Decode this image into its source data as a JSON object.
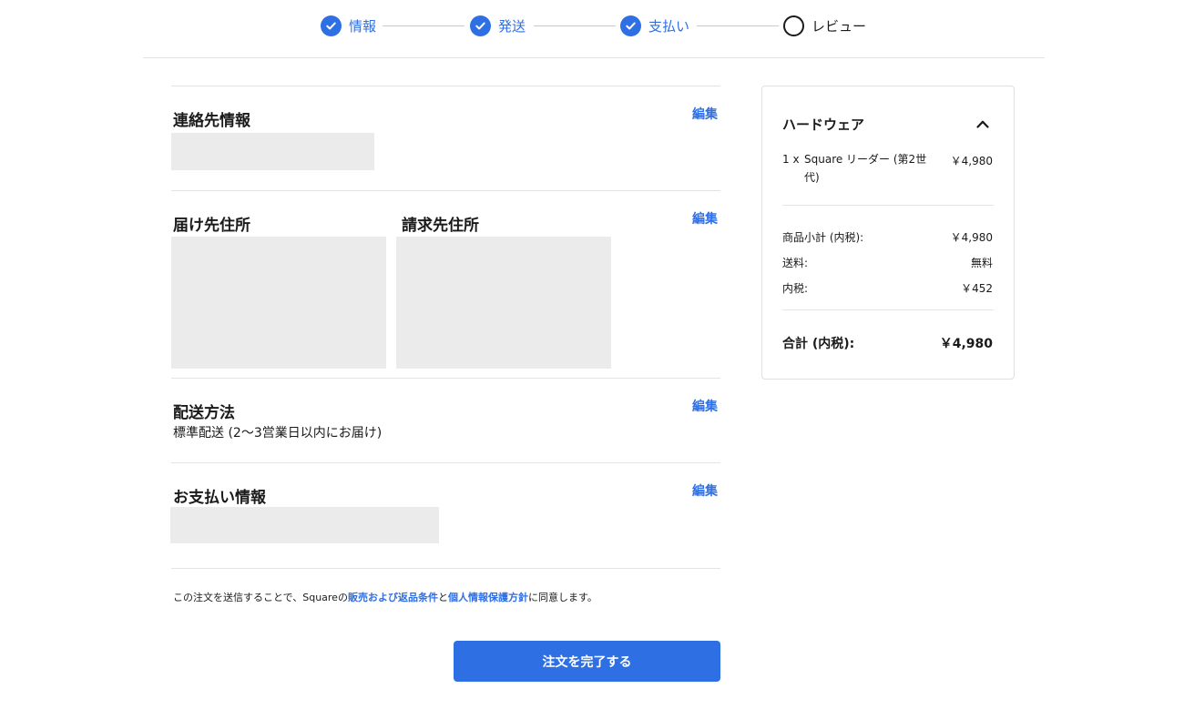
{
  "stepper": {
    "steps": [
      {
        "label": "情報",
        "state": "complete"
      },
      {
        "label": "発送",
        "state": "complete"
      },
      {
        "label": "支払い",
        "state": "complete"
      },
      {
        "label": "レビュー",
        "state": "pending"
      }
    ]
  },
  "sections": {
    "contact": {
      "title": "連絡先情報",
      "edit_label": "編集"
    },
    "addresses": {
      "shipping_title": "届け先住所",
      "billing_title": "請求先住所",
      "edit_label": "編集"
    },
    "shipping_method": {
      "title": "配送方法",
      "value": "標準配送 (2〜3営業日以内にお届け)",
      "edit_label": "編集"
    },
    "payment": {
      "title": "お支払い情報",
      "edit_label": "編集"
    }
  },
  "terms": {
    "prefix": "この注文を送信することで、Square",
    "no": "の",
    "link_sales": "販売および返品条件",
    "and": "と",
    "link_privacy": "個人情報保護方針",
    "suffix": "に同意します。"
  },
  "submit": {
    "label": "注文を完了する"
  },
  "summary": {
    "title": "ハードウェア",
    "item": {
      "qty": "1 x",
      "name": "Square リーダー (第2世代)",
      "price": "￥4,980"
    },
    "subtotal": {
      "label": "商品小計 (内税):",
      "value": "￥4,980"
    },
    "shipping": {
      "label": "送料:",
      "value": "無料"
    },
    "tax": {
      "label": "内税:",
      "value": "￥452"
    },
    "total": {
      "label": "合計 (内税):",
      "value": "￥4,980"
    }
  },
  "icons": {
    "check": "check-icon",
    "collapse": "chevron-up-icon"
  },
  "colors": {
    "accent": "#2f6fe4",
    "placeholder": "#ebebeb"
  }
}
